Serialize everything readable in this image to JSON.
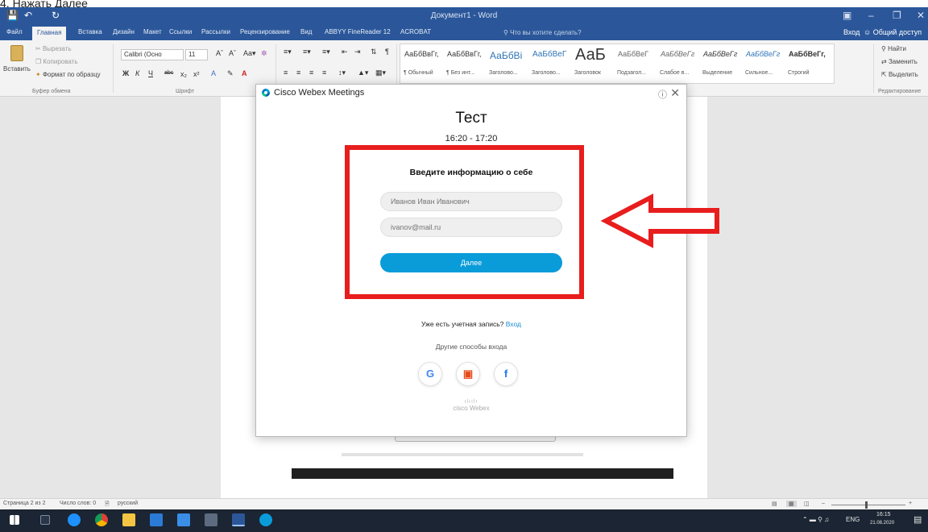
{
  "caption": "4. Нажать Далее",
  "word": {
    "title": "Документ1 - Word",
    "tabs": [
      {
        "label": "Файл"
      },
      {
        "label": "Главная"
      },
      {
        "label": "Вставка"
      },
      {
        "label": "Дизайн"
      },
      {
        "label": "Макет"
      },
      {
        "label": "Ссылки"
      },
      {
        "label": "Рассылки"
      },
      {
        "label": "Рецензирование"
      },
      {
        "label": "Вид"
      },
      {
        "label": "ABBYY FineReader 12"
      },
      {
        "label": "ACROBAT"
      }
    ],
    "tell_me": "Что вы хотите сделать?",
    "sign_in": "Вход",
    "share": "Общий доступ",
    "clipboard": {
      "paste": "Вставить",
      "cut": "Вырезать",
      "copy": "Копировать",
      "format_painter": "Формат по образцу",
      "group": "Буфер обмена"
    },
    "font": {
      "name": "Calibri (Осно",
      "size": "11",
      "group": "Шрифт"
    },
    "styles": [
      {
        "sample": "АаБбВвГг,",
        "name": "¶ Обычный"
      },
      {
        "sample": "АаБбВвГг,",
        "name": "¶ Без инт..."
      },
      {
        "sample": "АаБбВі",
        "name": "Заголово..."
      },
      {
        "sample": "АаБбВеГ",
        "name": "Заголово..."
      },
      {
        "sample": "АаБ",
        "name": "Заголовок"
      },
      {
        "sample": "АаБбВеГ",
        "name": "Подзагол..."
      },
      {
        "sample": "АаБбВеГг",
        "name": "Слабое в..."
      },
      {
        "sample": "АаБбВеГг",
        "name": "Выделение"
      },
      {
        "sample": "АаБбВеГг",
        "name": "Сильное..."
      },
      {
        "sample": "АаБбВеГг,",
        "name": "Строгий"
      }
    ],
    "editing": {
      "find": "Найти",
      "replace": "Заменить",
      "select": "Выделить",
      "group": "Редактирование"
    },
    "status": {
      "page": "Страница 2 из 2",
      "words": "Число слов: 0",
      "language": "русский"
    }
  },
  "webex": {
    "window_title": "Cisco Webex Meetings",
    "meeting_title": "Тест",
    "meeting_time": "16:20 - 17:20",
    "form_heading": "Введите информацию о себе",
    "name_placeholder": "Иванов Иван Иванович",
    "email_placeholder": "ivanov@mail.ru",
    "next_button": "Далее",
    "has_account": "Уже есть учетная запись?",
    "sign_in_link": "Вход",
    "other_ways": "Другие способы входа",
    "logo_text": "cisco Webex",
    "colors": {
      "accent": "#0a9bd9",
      "link": "#1c8ed6",
      "highlight": "#e81d1d"
    }
  },
  "taskbar": {
    "lang": "ENG",
    "time": "16:15",
    "date": "21.08.2020"
  }
}
